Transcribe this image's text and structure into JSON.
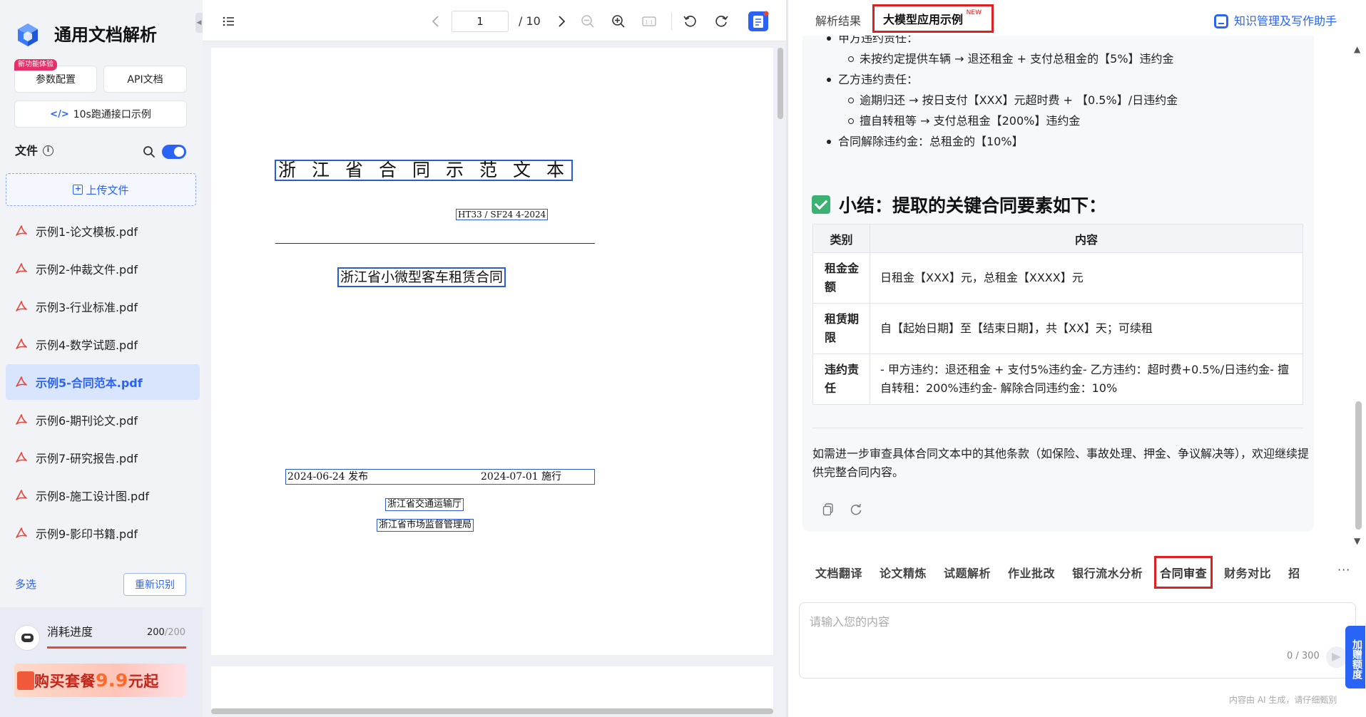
{
  "sidebar": {
    "app_title": "通用文档解析",
    "badge": "新功能体验",
    "params_label": "参数配置",
    "api_label": "API文档",
    "demo_label": "10s跑通接口示例",
    "files_label": "文件",
    "upload_label": "上传文件",
    "files": [
      {
        "name": "示例1-论文模板.pdf"
      },
      {
        "name": "示例2-仲裁文件.pdf"
      },
      {
        "name": "示例3-行业标准.pdf"
      },
      {
        "name": "示例4-数学试题.pdf"
      },
      {
        "name": "示例5-合同范本.pdf"
      },
      {
        "name": "示例6-期刊论文.pdf"
      },
      {
        "name": "示例7-研究报告.pdf"
      },
      {
        "name": "示例8-施工设计图.pdf"
      },
      {
        "name": "示例9-影印书籍.pdf"
      }
    ],
    "active_file_index": 4,
    "multi_select": "多选",
    "reidentify": "重新识别",
    "usage_label": "消耗进度",
    "usage_used": "200",
    "usage_total": "/200",
    "usage_fraction": 1.0,
    "buy_prefix": "购买套餐",
    "buy_price": "9.9",
    "buy_suffix": "元起"
  },
  "viewer": {
    "current_page": "1",
    "total_pages": "/ 10",
    "document": {
      "title": "浙江省合同示范文本",
      "code": "HT33 / SF24 4-2024",
      "subtitle": "浙江省小微型客车租赁合同",
      "publish_date": "2024-06-24 发布",
      "effective_date": "2024-07-01 施行",
      "org1": "浙江省交通运输厅",
      "org2": "浙江省市场监督管理局"
    }
  },
  "right_panel": {
    "tab_result": "解析结果",
    "tab_llm": "大模型应用示例",
    "tab_llm_new": "NEW",
    "assistant_link": "知识管理及写作助手",
    "bullets": [
      {
        "level": 1,
        "text": "甲方违约责任："
      },
      {
        "level": 2,
        "text": "未按约定提供车辆 → 退还租金 + 支付总租金的【5%】违约金"
      },
      {
        "level": 1,
        "text": "乙方违约责任："
      },
      {
        "level": 2,
        "text": "逾期归还 → 按日支付【XXX】元超时费 + 【0.5%】/日违约金"
      },
      {
        "level": 2,
        "text": "擅自转租等 → 支付总租金【200%】违约金"
      },
      {
        "level": 1,
        "text": "合同解除违约金：总租金的【10%】"
      }
    ],
    "summary_title": "小结：提取的关键合同要素如下：",
    "table": {
      "headers": [
        "类别",
        "内容"
      ],
      "rows": [
        {
          "category": "租金金额",
          "content": "日租金【XXX】元，总租金【XXXX】元"
        },
        {
          "category": "租赁期限",
          "content": "自【起始日期】至【结束日期】，共【XX】天；可续租"
        },
        {
          "category": "违约责任",
          "content": "- 甲方违约：退还租金 + 支付5%违约金- 乙方违约：超时费+0.5%/日违约金- 擅自转租：200%违约金- 解除合同违约金：10%"
        }
      ]
    },
    "closing": "如需进一步审查具体合同文本中的其他条款（如保险、事故处理、押金、争议解决等），欢迎继续提供完整合同内容。",
    "app_tabs": [
      "文档翻译",
      "论文精炼",
      "试题解析",
      "作业批改",
      "银行流水分析",
      "合同审查",
      "财务对比",
      "招"
    ],
    "app_active": "合同审查",
    "more": "···",
    "input_placeholder": "请输入您的内容",
    "input_count": "0 / 300",
    "float_tag": "加赠额度",
    "ai_note": "内容由 AI 生成，请仔细甄别"
  },
  "colors": {
    "accent": "#2a64f6",
    "highlight_box": "#e02020",
    "active_file_bg": "#d9e4fd"
  }
}
